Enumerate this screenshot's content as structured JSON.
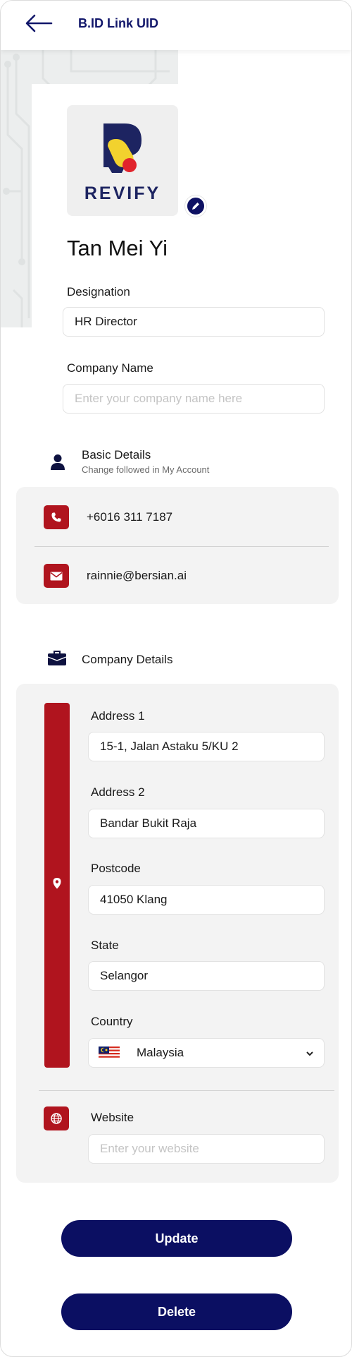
{
  "header": {
    "title": "B.ID Link UID"
  },
  "profile": {
    "logo_text": "REVIFY",
    "name": "Tan Mei Yi",
    "designation_label": "Designation",
    "designation_value": "HR Director",
    "company_label": "Company Name",
    "company_placeholder": "Enter your company name here"
  },
  "basic_details": {
    "title": "Basic Details",
    "subtitle": "Change followed in My Account",
    "phone": "+6016 311 7187",
    "email": "rainnie@bersian.ai"
  },
  "company_details": {
    "title": "Company Details",
    "address1_label": "Address 1",
    "address1_value": "15-1, Jalan Astaku 5/KU 2",
    "address2_label": "Address 2",
    "address2_value": "Bandar Bukit Raja",
    "postcode_label": "Postcode",
    "postcode_value": "41050 Klang",
    "state_label": "State",
    "state_value": "Selangor",
    "country_label": "Country",
    "country_value": "Malaysia",
    "website_label": "Website",
    "website_placeholder": "Enter your website"
  },
  "actions": {
    "update_label": "Update",
    "delete_label": "Delete"
  },
  "colors": {
    "navy": "#0b0f62",
    "red": "#b0141e",
    "card_bg": "#f3f3f3"
  }
}
